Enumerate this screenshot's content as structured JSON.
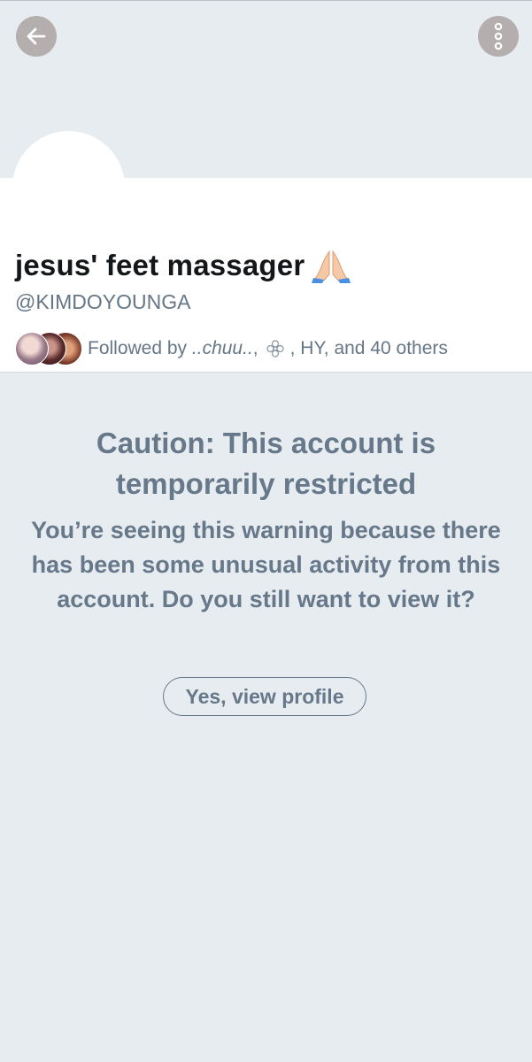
{
  "header": {
    "back_icon": "arrow-left-icon",
    "more_icon": "more-vertical-icon"
  },
  "profile": {
    "display_name": "jesus' feet massager",
    "name_emoji": "folded-hands-emoji",
    "handle": "@KIMDOYOUNGA",
    "followed_by_prefix": "Followed by",
    "followed_by_first": "..chuu..",
    "followed_by_sep": ",",
    "followed_by_rest": ", HY, and 40 others"
  },
  "warning": {
    "title": "Caution: This account is temporarily restricted",
    "body": "You’re seeing this warning because there has been some unusual activity from this account. Do you still want to view it?",
    "button_label": "Yes, view profile"
  },
  "colors": {
    "background": "#e6ecf0",
    "header_button": "#b4aeae",
    "warning_text": "#66788a",
    "secondary_text": "#657786"
  }
}
